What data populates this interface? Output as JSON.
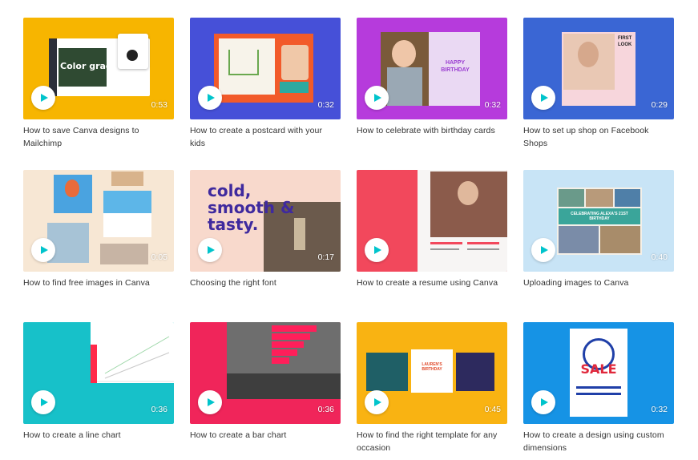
{
  "videos": [
    {
      "title": "How to save Canva designs to Mailchimp",
      "duration": "0:53",
      "thumb_text": "Color grade",
      "color": "#f7b500"
    },
    {
      "title": "How to create a postcard with your kids",
      "duration": "0:32",
      "color": "#4650d8"
    },
    {
      "title": "How to celebrate with birthday cards",
      "duration": "0:32",
      "thumb_text": "HAPPY BIRTHDAY",
      "color": "#b63bdc"
    },
    {
      "title": "How to set up shop on Facebook Shops",
      "duration": "0:29",
      "thumb_text": "FIRST LOOK",
      "color": "#3a66d4"
    },
    {
      "title": "How to find free images in Canva",
      "duration": "0:05",
      "color": "#f7e7d4"
    },
    {
      "title": "Choosing the right font",
      "duration": "0:17",
      "thumb_text": "cold, smooth & tasty.",
      "color": "#f8d9cc"
    },
    {
      "title": "How to create a resume using Canva",
      "duration": "",
      "color": "#f2485c"
    },
    {
      "title": "Uploading images to Canva",
      "duration": "0:40",
      "thumb_text": "CELEBRATING ALEXA'S 21ST BIRTHDAY",
      "color": "#c8e4f6"
    },
    {
      "title": "How to create a line chart",
      "duration": "0:36",
      "color": "#17c1c9"
    },
    {
      "title": "How to create a bar chart",
      "duration": "0:36",
      "color": "#f0255a"
    },
    {
      "title": "How to find the right template for any occasion",
      "duration": "0:45",
      "thumb_text": "LAUREN'S BIRTHDAY",
      "color": "#f9b312"
    },
    {
      "title": "How to create a design using custom dimensions",
      "duration": "0:32",
      "thumb_text": "SALE",
      "color": "#1693e5"
    }
  ]
}
